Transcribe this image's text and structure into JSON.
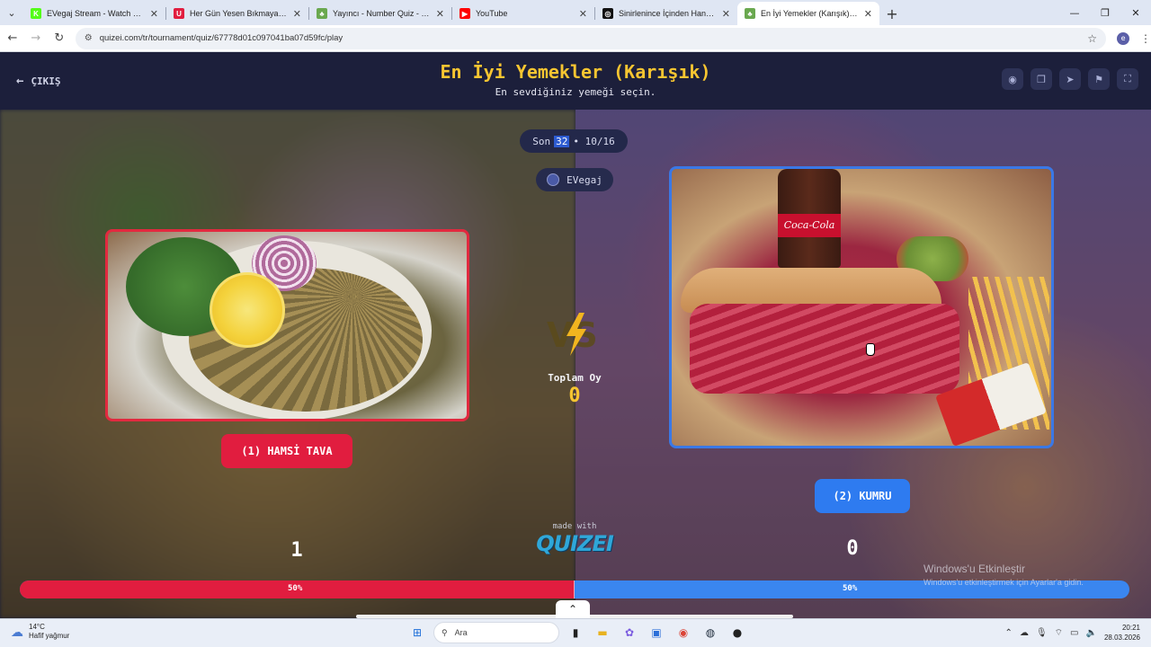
{
  "browser": {
    "tabs": [
      {
        "title": "EVegaj Stream - Watch Live on",
        "favicon_color": "#53fc18",
        "favicon_glyph": "K",
        "active": false
      },
      {
        "title": "Her Gün Yesen Bıkmayacağın Y",
        "favicon_color": "#e11d3f",
        "favicon_glyph": "U",
        "active": false
      },
      {
        "title": "Yayıncı - Number Quiz - Quizei",
        "favicon_color": "#6aa84f",
        "favicon_glyph": "♣",
        "active": false
      },
      {
        "title": "YouTube",
        "favicon_color": "#ff0000",
        "favicon_glyph": "▶",
        "active": false
      },
      {
        "title": "Sinirlenince İçinden Hangi Hay",
        "favicon_color": "#111111",
        "favicon_glyph": "◎",
        "active": false
      },
      {
        "title": "En İyi Yemekler (Karışık) - Tier L",
        "favicon_color": "#6aa84f",
        "favicon_glyph": "♣",
        "active": true
      }
    ],
    "url": "quizei.com/tr/tournament/quiz/67778d01c097041ba07d59fc/play",
    "profile_initial": "e"
  },
  "quiz": {
    "exit_label": "ÇIKIŞ",
    "title": "En İyi Yemekler (Karışık)",
    "subtitle": "En sevdiğiniz yemeği seçin.",
    "round_prefix": "Son",
    "round_number": "32",
    "round_progress": "• 10/16",
    "username": "EVegaj",
    "total_votes_label": "Toplam Oy",
    "total_votes": "0",
    "made_with": "made with",
    "logo": "QUIZEI",
    "left": {
      "label": "(1) HAMSİ TAVA",
      "count": "1",
      "percent": "50%",
      "percent_value": 50,
      "color": "#e11d3f"
    },
    "right": {
      "label": "(2) KUMRU",
      "count": "0",
      "percent": "50%",
      "color": "#2e7bf0"
    },
    "right_image_brand": "Coca-Cola"
  },
  "windows_activation": {
    "title": "Windows'u Etkinleştir",
    "subtitle": "Windows'u etkinleştirmek için Ayarlar'a gidin."
  },
  "taskbar": {
    "temperature": "14°C",
    "weather": "Hafif yağmur",
    "search_placeholder": "Ara",
    "time": "20:21",
    "date": "28.03.2026"
  }
}
